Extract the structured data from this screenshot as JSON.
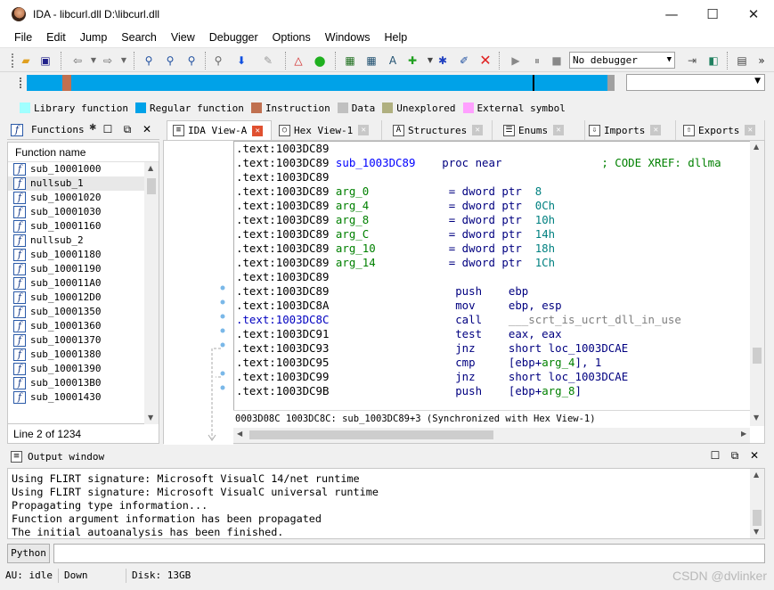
{
  "window": {
    "title": "IDA - libcurl.dll D:\\libcurl.dll",
    "minimize": "—",
    "maximize": "☐",
    "close": "✕"
  },
  "menu": [
    "File",
    "Edit",
    "Jump",
    "Search",
    "View",
    "Debugger",
    "Options",
    "Windows",
    "Help"
  ],
  "toolbar": {
    "debugger_select": "No debugger"
  },
  "legend": [
    {
      "label": "Library function",
      "color": "#a0ffff"
    },
    {
      "label": "Regular function",
      "color": "#00a2e8"
    },
    {
      "label": "Instruction",
      "color": "#c07050"
    },
    {
      "label": "Data",
      "color": "#c0c0c0"
    },
    {
      "label": "Unexplored",
      "color": "#b0b080"
    },
    {
      "label": "External symbol",
      "color": "#ffa0ff"
    }
  ],
  "functions_panel": {
    "title": "Functions",
    "column_header": "Function name",
    "items": [
      "sub_10001000",
      "nullsub_1",
      "sub_10001020",
      "sub_10001030",
      "sub_10001160",
      "nullsub_2",
      "sub_10001180",
      "sub_10001190",
      "sub_100011A0",
      "sub_100012D0",
      "sub_10001350",
      "sub_10001360",
      "sub_10001370",
      "sub_10001380",
      "sub_10001390",
      "sub_100013B0",
      "sub_10001430"
    ],
    "status": "Line 2 of 1234"
  },
  "tabs": [
    {
      "label": "IDA View-A"
    },
    {
      "label": "Hex View-1"
    },
    {
      "label": "Structures"
    },
    {
      "label": "Enums"
    },
    {
      "label": "Imports"
    },
    {
      "label": "Exports"
    }
  ],
  "code": {
    "lines": [
      {
        "addr": ".text:1003DC89",
        "name": "",
        "op": "",
        "args": []
      },
      {
        "addr": ".text:1003DC89",
        "name": "sub_1003DC89",
        "op": "proc near",
        "comment": "; CODE XREF: dllma"
      },
      {
        "addr": ".text:1003DC89",
        "name": "",
        "op": ""
      },
      {
        "addr": ".text:1003DC89",
        "arg": "arg_0",
        "eq": "= dword ptr",
        "val": "8"
      },
      {
        "addr": ".text:1003DC89",
        "arg": "arg_4",
        "eq": "= dword ptr",
        "val": "0Ch"
      },
      {
        "addr": ".text:1003DC89",
        "arg": "arg_8",
        "eq": "= dword ptr",
        "val": "10h"
      },
      {
        "addr": ".text:1003DC89",
        "arg": "arg_C",
        "eq": "= dword ptr",
        "val": "14h"
      },
      {
        "addr": ".text:1003DC89",
        "arg": "arg_10",
        "eq": "= dword ptr",
        "val": "18h"
      },
      {
        "addr": ".text:1003DC89",
        "arg": "arg_14",
        "eq": "= dword ptr",
        "val": "1Ch"
      },
      {
        "addr": ".text:1003DC89"
      },
      {
        "addr": ".text:1003DC89",
        "ins": "push",
        "ops": "ebp"
      },
      {
        "addr": ".text:1003DC8A",
        "ins": "mov",
        "ops": "ebp, esp"
      },
      {
        "addr": ".text:1003DC8C",
        "ins": "call",
        "ops": "___scrt_is_ucrt_dll_in_use"
      },
      {
        "addr": ".text:1003DC91",
        "ins": "test",
        "ops": "eax, eax"
      },
      {
        "addr": ".text:1003DC93",
        "ins": "jnz",
        "ops": "short loc_1003DCAE"
      },
      {
        "addr": ".text:1003DC95",
        "ins": "cmp",
        "ops_pre": "[ebp+",
        "ops_arg": "arg_4",
        "ops_post": "], 1"
      },
      {
        "addr": ".text:1003DC99",
        "ins": "jnz",
        "ops": "short loc_1003DCAE"
      },
      {
        "addr": ".text:1003DC9B",
        "ins": "push",
        "ops_pre": "[ebp+",
        "ops_arg": "arg_8",
        "ops_post": "]"
      }
    ],
    "status": "0003D08C 1003DC8C: sub_1003DC89+3 (Synchronized with Hex View-1)"
  },
  "output": {
    "title": "Output window",
    "lines": [
      "Using FLIRT signature: Microsoft VisualC 14/net runtime",
      "Using FLIRT signature: Microsoft VisualC universal runtime",
      "Propagating type information...",
      "Function argument information has been propagated",
      "The initial autoanalysis has been finished."
    ]
  },
  "command": {
    "language": "Python"
  },
  "statusbar": {
    "au_label": "AU:",
    "au_state": "idle",
    "direction": "Down",
    "disk": "Disk: 13GB"
  },
  "watermark": "CSDN @dvlinker"
}
